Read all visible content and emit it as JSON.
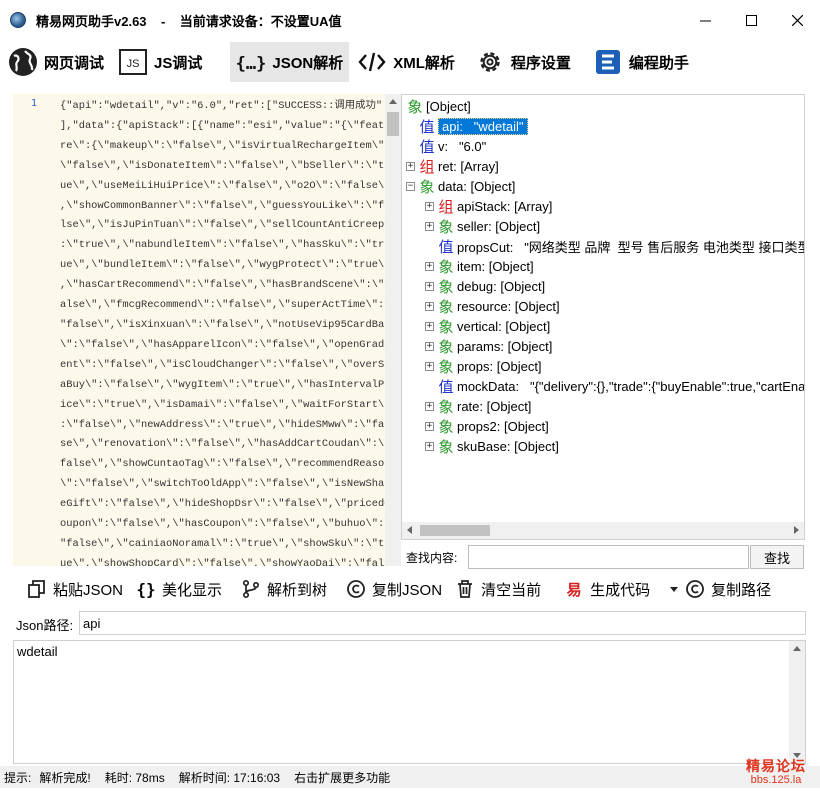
{
  "window": {
    "title": "精易网页助手v2.63    -    当前请求设备：不设置UA值"
  },
  "toolbar": {
    "items": [
      {
        "label": "网页调试",
        "icon": "globe-icon",
        "active": false
      },
      {
        "label": "JS调试",
        "icon": "js-icon",
        "active": false
      },
      {
        "label": "JSON解析",
        "icon": "json-brace-icon",
        "active": true
      },
      {
        "label": "XML解析",
        "icon": "xml-code-icon",
        "active": false
      },
      {
        "label": "程序设置",
        "icon": "gear-icon",
        "active": false
      },
      {
        "label": "编程助手",
        "icon": "e-logo-icon",
        "active": false
      }
    ]
  },
  "code_editor": {
    "line_number": "1",
    "text": "{\"api\":\"wdetail\",\"v\":\"6.0\",\"ret\":[\"SUCCESS::调用成功\"\n],\"data\":{\"apiStack\":[{\"name\":\"esi\",\"value\":\"{\\\"featu\nre\\\":{\\\"makeup\\\":\\\"false\\\",\\\"isVirtualRechargeItem\\\":\n\\\"false\\\",\\\"isDonateItem\\\":\\\"false\\\",\\\"bSeller\\\":\\\"tr\nue\\\",\\\"useMeiLiHuiPrice\\\":\\\"false\\\",\\\"o2O\\\":\\\"false\\\"\n,\\\"showCommonBanner\\\":\\\"false\\\",\\\"guessYouLike\\\":\\\"fa\nlse\\\",\\\"isJuPinTuan\\\":\\\"false\\\",\\\"sellCountAntiCreep\\\"\n:\\\"true\\\",\\\"nabundleItem\\\":\\\"false\\\",\\\"hasSku\\\":\\\"tr\nue\\\",\\\"bundleItem\\\":\\\"false\\\",\\\"wygProtect\\\":\\\"true\\\"\n,\\\"hasCartRecommend\\\":\\\"false\\\",\\\"hasBrandScene\\\":\\\"f\nalse\\\",\\\"fmcgRecommend\\\":\\\"false\\\",\\\"superActTime\\\":\\\n\"false\\\",\\\"isXinxuan\\\":\\\"false\\\",\\\"notUseVip95CardBar\n\\\":\\\"false\\\",\\\"hasApparelIcon\\\":\\\"false\\\",\\\"openGradi\nent\\\":\\\"false\\\",\\\"isCloudChanger\\\":\\\"false\\\",\\\"overSe\naBuy\\\":\\\"false\\\",\\\"wygItem\\\":\\\"true\\\",\\\"hasIntervalPr\nice\\\":\\\"true\\\",\\\"isDamai\\\":\\\"false\\\",\\\"waitForStart\\\"\n:\\\"false\\\",\\\"newAddress\\\":\\\"true\\\",\\\"hideSMww\\\":\\\"fal\nse\\\",\\\"renovation\\\":\\\"false\\\",\\\"hasAddCartCoudan\\\":\\\"\nfalse\\\",\\\"showCuntaoTag\\\":\\\"false\\\",\\\"recommendReason\n\\\":\\\"false\\\",\\\"switchToOldApp\\\":\\\"false\\\",\\\"isNewShar\neGift\\\":\\\"false\\\",\\\"hideShopDsr\\\":\\\"false\\\",\\\"pricedC\noupon\\\":\\\"false\\\",\\\"hasCoupon\\\":\\\"false\\\",\\\"buhuo\\\":\\\n\"false\\\",\\\"cainiaoNoramal\\\":\\\"true\\\",\\\"showSku\\\":\\\"tr\nue\\\",\\\"showShopCard\\\":\\\"false\\\",\\\"showYaoDai\\\":\\\"fals\ne\\\",\\\"isXXSale\\\":\\\"false\\\",\\\"enableDpbModule\\\":\\\"fals\ne\\\",\\\"showLiteAppRec\\\":\\\"false\\\",\\\"showTmallApp\\\":\\\"f\nalse\\\",\\\"hasNewCombo\\\":\\\"false\\\",\\\"noShareGroup\\\":\\\"t\nrue\\\",\\\"showSkuProRate\\\":\\\"false\\\",\\\"hasAddTmallCartC\noudan\\\":\\\"false\\\",\\\"multistage\\\":\\\"false\\\",\\\"hasQuali\nfication\\\":\\\"false\\\",\\\"isTrensp\\\":\\\"false\\\",\\\"series\\\""
  },
  "tree": {
    "nodes": [
      {
        "type": "obj",
        "glyph": "象",
        "text": "[Object]",
        "expander": "",
        "depth": 0,
        "selected": false
      },
      {
        "type": "val",
        "glyph": "值",
        "text": "api:   \"wdetail\"",
        "expander": "",
        "depth": 1,
        "selected": true
      },
      {
        "type": "val",
        "glyph": "值",
        "text": "v:   \"6.0\"",
        "expander": "",
        "depth": 1,
        "selected": false
      },
      {
        "type": "arr",
        "glyph": "组",
        "text": "ret: [Array]",
        "expander": "+",
        "depth": 1,
        "selected": false
      },
      {
        "type": "obj",
        "glyph": "象",
        "text": "data: [Object]",
        "expander": "−",
        "depth": 1,
        "selected": false
      },
      {
        "type": "arr",
        "glyph": "组",
        "text": "apiStack: [Array]",
        "expander": "+",
        "depth": 2,
        "selected": false
      },
      {
        "type": "obj",
        "glyph": "象",
        "text": "seller: [Object]",
        "expander": "+",
        "depth": 2,
        "selected": false
      },
      {
        "type": "val",
        "glyph": "值",
        "text": "propsCut:   \"网络类型 品牌  型号 售后服务 电池类型 接口类型 …",
        "expander": "",
        "depth": 2,
        "selected": false
      },
      {
        "type": "obj",
        "glyph": "象",
        "text": "item: [Object]",
        "expander": "+",
        "depth": 2,
        "selected": false
      },
      {
        "type": "obj",
        "glyph": "象",
        "text": "debug: [Object]",
        "expander": "+",
        "depth": 2,
        "selected": false
      },
      {
        "type": "obj",
        "glyph": "象",
        "text": "resource: [Object]",
        "expander": "+",
        "depth": 2,
        "selected": false
      },
      {
        "type": "obj",
        "glyph": "象",
        "text": "vertical: [Object]",
        "expander": "+",
        "depth": 2,
        "selected": false
      },
      {
        "type": "obj",
        "glyph": "象",
        "text": "params: [Object]",
        "expander": "+",
        "depth": 2,
        "selected": false
      },
      {
        "type": "obj",
        "glyph": "象",
        "text": "props: [Object]",
        "expander": "+",
        "depth": 2,
        "selected": false
      },
      {
        "type": "val",
        "glyph": "值",
        "text": "mockData:   \"{\"delivery\":{},\"trade\":{\"buyEnable\":true,\"cartEna",
        "expander": "",
        "depth": 2,
        "selected": false
      },
      {
        "type": "obj",
        "glyph": "象",
        "text": "rate: [Object]",
        "expander": "+",
        "depth": 2,
        "selected": false
      },
      {
        "type": "obj",
        "glyph": "象",
        "text": "props2: [Object]",
        "expander": "+",
        "depth": 2,
        "selected": false
      },
      {
        "type": "obj",
        "glyph": "象",
        "text": "skuBase: [Object]",
        "expander": "+",
        "depth": 2,
        "selected": false
      }
    ]
  },
  "search": {
    "label": "查找内容:",
    "value": "",
    "button": "查找"
  },
  "actions": [
    {
      "label": "粘贴JSON",
      "icon": "paste-icon"
    },
    {
      "label": "美化显示",
      "icon": "braces-icon"
    },
    {
      "label": "解析到树",
      "icon": "tree-branch-icon"
    },
    {
      "label": "复制JSON",
      "icon": "copyright-circle-icon"
    },
    {
      "label": "清空当前",
      "icon": "trash-icon"
    },
    {
      "label": "生成代码",
      "icon": "yi-logo-icon"
    },
    {
      "label": "复制路径",
      "icon": "copyright-circle-icon"
    }
  ],
  "json_path": {
    "label": "Json路径:",
    "value": "api"
  },
  "value_output": {
    "text": "wdetail"
  },
  "status": {
    "prefix": "提示:",
    "message": "解析完成!",
    "elapsed": "耗时: 78ms",
    "parse_time": "解析时间: 17:16:03",
    "hint": "右击扩展更多功能"
  },
  "watermark": {
    "line1": "精易论坛",
    "line2": "bbs.125.la"
  },
  "colors": {
    "accent": "#0078d7",
    "object_icon": "#2d9a2d",
    "array_icon": "#d42020",
    "value_icon": "#2034c8",
    "code_background": "#fdf9ea"
  }
}
